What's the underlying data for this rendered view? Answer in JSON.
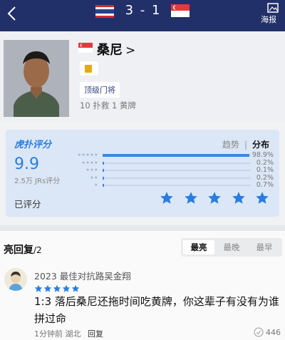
{
  "header": {
    "home_score": "3",
    "separator": "-",
    "away_score": "1",
    "poster_label": "海报"
  },
  "player": {
    "name": "桑尼",
    "chevron": ">",
    "tag": "顶级门将",
    "stats": "10 扑救 1 黄牌"
  },
  "rating": {
    "logo": "虎扑评分",
    "tab_trend": "趋势",
    "tab_separator": "|",
    "tab_distribution": "分布",
    "score": "9.9",
    "count": "2.5万 JRs评分",
    "rated_label": "已评分",
    "distribution": [
      {
        "stars": "★★★★★",
        "percent": "98.9%",
        "value": 0.989
      },
      {
        "stars": "★★★★",
        "percent": "0.2%",
        "value": 0.002
      },
      {
        "stars": "★★★",
        "percent": "0.1%",
        "value": 0.001
      },
      {
        "stars": "★★",
        "percent": "0.2%",
        "value": 0.002
      },
      {
        "stars": "★",
        "percent": "0.7%",
        "value": 0.007
      }
    ],
    "my_stars": 5
  },
  "replies": {
    "title": "亮回复",
    "count": "/2",
    "sort": [
      "最亮",
      "最晚",
      "最早"
    ],
    "comment": {
      "user": "2023 最佳对抗路吴金翔",
      "stars": 5,
      "text": "1:3 落后桑尼还拖时间吃黄牌，你这辈子有没有为谁拼过命",
      "time": "1分钟前",
      "location": "湖北",
      "reply": "回复",
      "likes": "446"
    }
  },
  "colors": {
    "header_bg": "#22306a",
    "accent": "#2a7de0",
    "rating_bg": "#dbe7f6",
    "yellow_card": "#e7a913"
  },
  "icons": [
    "back-icon",
    "poster-icon",
    "star-icon",
    "like-icon"
  ]
}
